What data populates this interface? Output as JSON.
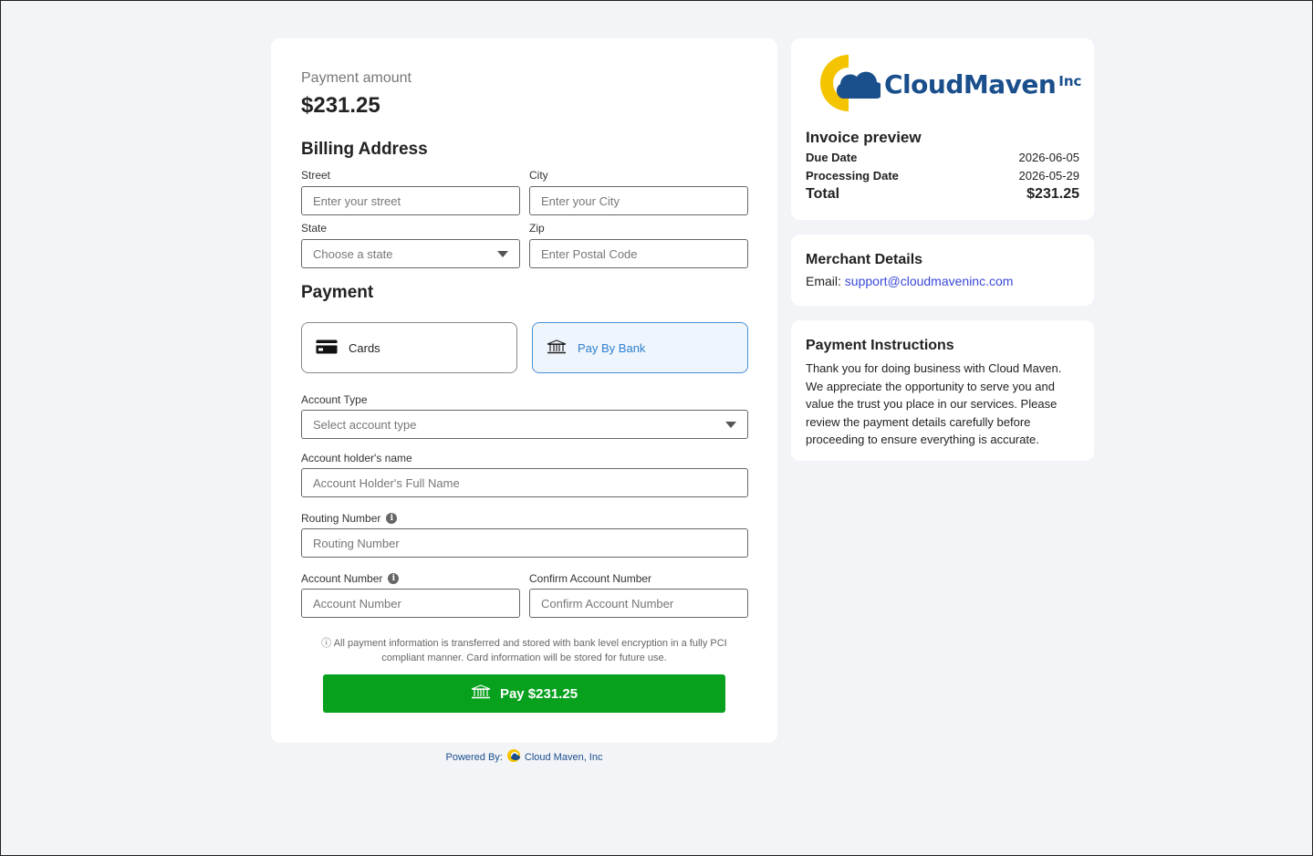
{
  "payment": {
    "amount_label": "Payment amount",
    "amount_value": "$231.25"
  },
  "billing": {
    "title": "Billing Address",
    "street_label": "Street",
    "street_placeholder": "Enter your street",
    "city_label": "City",
    "city_placeholder": "Enter your City",
    "state_label": "State",
    "state_placeholder": "Choose a state",
    "zip_label": "Zip",
    "zip_placeholder": "Enter Postal Code"
  },
  "payment_method": {
    "title": "Payment",
    "cards_label": "Cards",
    "bank_label": "Pay By Bank",
    "selected": "Pay By Bank"
  },
  "bank_form": {
    "account_type_label": "Account Type",
    "account_type_placeholder": "Select account type",
    "holder_label": "Account holder's name",
    "holder_placeholder": "Account Holder's Full Name",
    "routing_label": "Routing Number",
    "routing_placeholder": "Routing Number",
    "account_label": "Account Number",
    "account_placeholder": "Account Number",
    "confirm_label": "Confirm Account Number",
    "confirm_placeholder": "Confirm Account Number"
  },
  "note": "ⓘ All payment information is transferred and stored with bank level encryption in a fully PCI compliant manner. Card information will be stored for future use.",
  "pay_button": "Pay $231.25",
  "powered": {
    "prefix": "Powered By:",
    "company": "Cloud Maven, Inc"
  },
  "brand": {
    "name": "CloudMaven",
    "suffix": "Inc",
    "primary_color": "#1a4f8c",
    "accent_color": "#f5c400"
  },
  "invoice": {
    "title": "Invoice preview",
    "due_label": "Due Date",
    "due_value": "2026-06-05",
    "processing_label": "Processing Date",
    "processing_value": "2026-05-29",
    "total_label": "Total",
    "total_value": "$231.25"
  },
  "merchant": {
    "title": "Merchant Details",
    "email_label": "Email:",
    "email_value": "support@cloudmaveninc.com"
  },
  "instructions": {
    "title": "Payment Instructions",
    "text": "Thank you for doing business with Cloud Maven. We appreciate the opportunity to serve you and value the trust you place in our services. Please review the payment details carefully before proceeding to ensure everything is accurate."
  },
  "colors": {
    "pay_button": "#07a11e",
    "selected_border": "#4a8fd8",
    "link": "#3a48d8"
  }
}
